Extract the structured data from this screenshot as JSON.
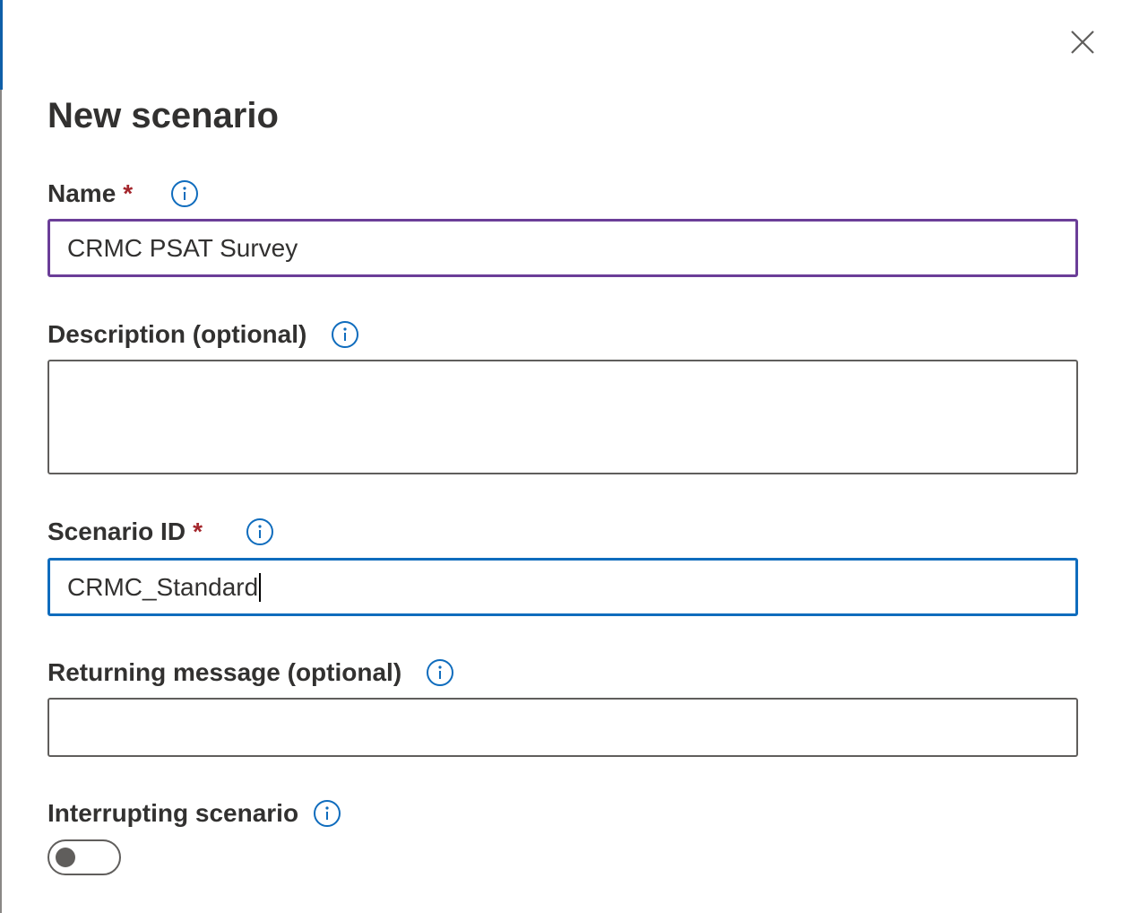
{
  "panel": {
    "title": "New scenario",
    "close_icon": "close-icon"
  },
  "fields": {
    "name": {
      "label": "Name",
      "required_mark": "*",
      "value": "CRMC PSAT Survey",
      "info_icon": "info-icon"
    },
    "description": {
      "label": "Description (optional)",
      "value": "",
      "info_icon": "info-icon"
    },
    "scenario_id": {
      "label": "Scenario ID",
      "required_mark": "*",
      "value": "CRMC_Standard",
      "info_icon": "info-icon"
    },
    "returning_message": {
      "label": "Returning message (optional)",
      "value": "",
      "info_icon": "info-icon"
    },
    "interrupting": {
      "label": "Interrupting scenario",
      "toggle_on": false,
      "info_icon": "info-icon"
    }
  },
  "colors": {
    "accent_blue": "#0f6cbd",
    "focus_purple": "#6b3e98",
    "required_red": "#a4262c",
    "text": "#323130",
    "border": "#605e5c"
  }
}
